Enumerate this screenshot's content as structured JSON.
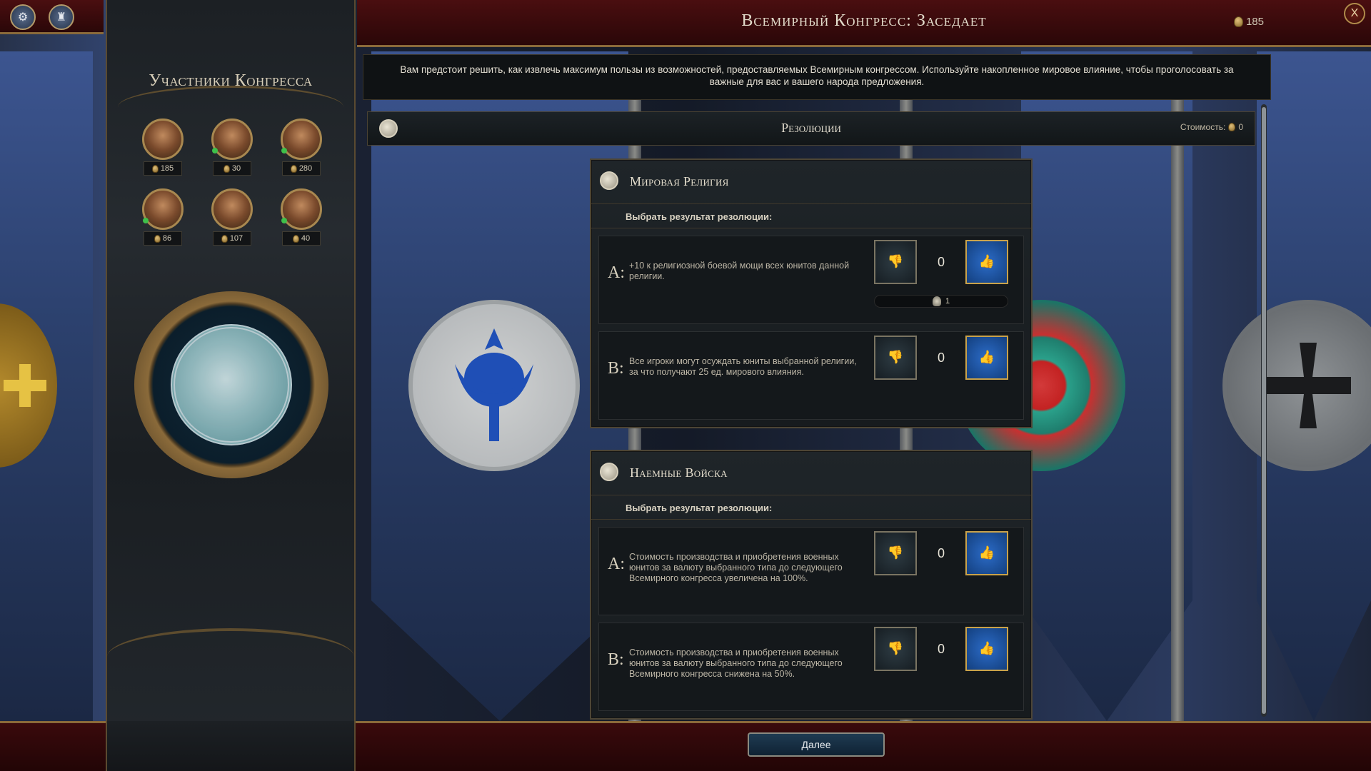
{
  "header": {
    "title": "Всемирный Конгресс: Заседает",
    "influence": "185",
    "close_label": "X"
  },
  "corner_buttons": {
    "left_glyph": "⚙",
    "right_glyph": "♜"
  },
  "congress_panel": {
    "title": "Участники Конгресса",
    "members": [
      {
        "influence": "185",
        "has_dot": false
      },
      {
        "influence": "30",
        "has_dot": true
      },
      {
        "influence": "280",
        "has_dot": true
      },
      {
        "influence": "86",
        "has_dot": true
      },
      {
        "influence": "107",
        "has_dot": false
      },
      {
        "influence": "40",
        "has_dot": true
      }
    ]
  },
  "description": "Вам предстоит решить, как извлечь максимум пользы из возможностей, предоставляемых Всемирным конгрессом. Используйте накопленное мировое влияние, чтобы проголосовать за важные для вас и вашего народа предложения.",
  "resolutions_bar": {
    "title": "Резолюции",
    "cost_label": "Стоимость:",
    "cost_value": "0"
  },
  "cards": [
    {
      "title": "Мировая Религия",
      "subtitle": "Выбрать результат резолюции:",
      "options": [
        {
          "letter": "A:",
          "text": "+10 к религиозной боевой мощи всех юнитов данной религии.",
          "votes": "0",
          "delegates": "1"
        },
        {
          "letter": "B:",
          "text": "Все игроки могут осуждать юниты выбранной религии, за что получают 25 ед. мирового влияния.",
          "votes": "0"
        }
      ]
    },
    {
      "title": "Наемные Войска",
      "subtitle": "Выбрать результат резолюции:",
      "options": [
        {
          "letter": "A:",
          "text": "Стоимость производства и приобретения военных юнитов за валюту выбранного типа до следующего Всемирного конгресса увеличена на 100%.",
          "votes": "0"
        },
        {
          "letter": "B:",
          "text": "Стоимость производства и приобретения военных юнитов за валюту выбранного типа до следующего Всемирного конгресса снижена на 50%.",
          "votes": "0"
        }
      ]
    }
  ],
  "vote_glyphs": {
    "down": "👎",
    "up": "👍"
  },
  "next_button": "Далее",
  "colors": {
    "accent_gold": "#8a6a3a",
    "header_red": "#4a0e10",
    "vote_up_blue": "#2c6cc8",
    "dot_green": "#3ec04a"
  }
}
